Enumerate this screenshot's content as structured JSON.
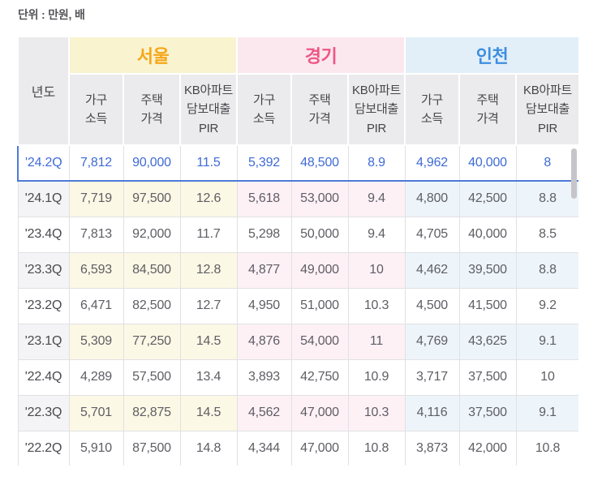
{
  "unit_label": "단위 : 만원, 배",
  "table": {
    "year_header": "년도",
    "regions": [
      {
        "name": "서울",
        "header_bg": "#FAF3D0",
        "header_color": "#F5A71B",
        "row_tint": "#FCF8E6"
      },
      {
        "name": "경기",
        "header_bg": "#FBE8EF",
        "header_color": "#EF5585",
        "row_tint": "#FDF1F6"
      },
      {
        "name": "인천",
        "header_bg": "#E2EFF8",
        "header_color": "#3E8EE0",
        "row_tint": "#EDF5FA"
      }
    ],
    "sub_headers": [
      [
        "가구",
        "소득"
      ],
      [
        "주택",
        "가격"
      ],
      [
        "KB아파트",
        "담보대출",
        "PIR"
      ]
    ],
    "year_col_tint": "#F4F4F6",
    "selected_text_color": "#3F6BD5",
    "selected_border_color": "#4D7AD8",
    "rows": [
      {
        "year": "'24.2Q",
        "selected": true,
        "values": [
          [
            "7,812",
            "90,000",
            "11.5"
          ],
          [
            "5,392",
            "48,500",
            "8.9"
          ],
          [
            "4,962",
            "40,000",
            "8"
          ]
        ]
      },
      {
        "year": "'24.1Q",
        "selected": false,
        "values": [
          [
            "7,719",
            "97,500",
            "12.6"
          ],
          [
            "5,618",
            "53,000",
            "9.4"
          ],
          [
            "4,800",
            "42,500",
            "8.8"
          ]
        ]
      },
      {
        "year": "'23.4Q",
        "selected": false,
        "values": [
          [
            "7,813",
            "92,000",
            "11.7"
          ],
          [
            "5,298",
            "50,000",
            "9.4"
          ],
          [
            "4,705",
            "40,000",
            "8.5"
          ]
        ]
      },
      {
        "year": "'23.3Q",
        "selected": false,
        "values": [
          [
            "6,593",
            "84,500",
            "12.8"
          ],
          [
            "4,877",
            "49,000",
            "10"
          ],
          [
            "4,462",
            "39,500",
            "8.8"
          ]
        ]
      },
      {
        "year": "'23.2Q",
        "selected": false,
        "values": [
          [
            "6,471",
            "82,500",
            "12.7"
          ],
          [
            "4,950",
            "51,000",
            "10.3"
          ],
          [
            "4,500",
            "41,500",
            "9.2"
          ]
        ]
      },
      {
        "year": "'23.1Q",
        "selected": false,
        "values": [
          [
            "5,309",
            "77,250",
            "14.5"
          ],
          [
            "4,876",
            "54,000",
            "11"
          ],
          [
            "4,769",
            "43,625",
            "9.1"
          ]
        ]
      },
      {
        "year": "'22.4Q",
        "selected": false,
        "values": [
          [
            "4,289",
            "57,500",
            "13.4"
          ],
          [
            "3,893",
            "42,750",
            "10.9"
          ],
          [
            "3,717",
            "37,500",
            "10"
          ]
        ]
      },
      {
        "year": "'22.3Q",
        "selected": false,
        "values": [
          [
            "5,701",
            "82,875",
            "14.5"
          ],
          [
            "4,562",
            "47,000",
            "10.3"
          ],
          [
            "4,116",
            "37,500",
            "9.1"
          ]
        ]
      },
      {
        "year": "'22.2Q",
        "selected": false,
        "values": [
          [
            "5,910",
            "87,500",
            "14.8"
          ],
          [
            "4,344",
            "47,000",
            "10.8"
          ],
          [
            "3,873",
            "42,000",
            "10.8"
          ]
        ]
      }
    ]
  }
}
